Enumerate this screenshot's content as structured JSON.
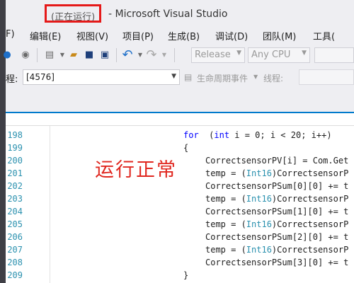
{
  "titlebar": {
    "status": "(正在运行)",
    "app_name": "- Microsoft Visual Studio"
  },
  "menu": {
    "items": [
      "F)",
      "编辑(E)",
      "视图(V)",
      "项目(P)",
      "生成(B)",
      "调试(D)",
      "团队(M)",
      "工具("
    ]
  },
  "toolbar": {
    "configuration": "Release",
    "platform": "Any CPU"
  },
  "debugbar": {
    "process_label": "程:",
    "process_value": "[4576]",
    "lifecycle_label": "生命周期事件",
    "thread_label": "线程:"
  },
  "editor": {
    "line_numbers": [
      "198",
      "199",
      "200",
      "201",
      "202",
      "203",
      "204",
      "205",
      "206",
      "207",
      "208",
      "209"
    ],
    "lines": [
      {
        "indent": "for",
        "parts": [
          [
            "kw",
            "for"
          ],
          [
            "",
            "  ("
          ],
          [
            "kw",
            "int"
          ],
          [
            "",
            " i = 0; i < 20; i++)"
          ]
        ]
      },
      {
        "parts": [
          [
            "",
            "{"
          ]
        ]
      },
      {
        "parts": [
          [
            "",
            "CorrectsensorPV[i] = Com.Get"
          ]
        ]
      },
      {
        "parts": [
          [
            "",
            "temp = ("
          ],
          [
            "ty",
            "Int16"
          ],
          [
            "",
            ")CorrectsensorP"
          ]
        ]
      },
      {
        "parts": [
          [
            "",
            "CorrectsensorPSum[0][0] += t"
          ]
        ]
      },
      {
        "parts": [
          [
            "",
            "temp = ("
          ],
          [
            "ty",
            "Int16"
          ],
          [
            "",
            ")CorrectsensorP"
          ]
        ]
      },
      {
        "parts": [
          [
            "",
            "CorrectsensorPSum[1][0] += t"
          ]
        ]
      },
      {
        "parts": [
          [
            "",
            "temp = ("
          ],
          [
            "ty",
            "Int16"
          ],
          [
            "",
            ")CorrectsensorP"
          ]
        ]
      },
      {
        "parts": [
          [
            "",
            "CorrectsensorPSum[2][0] += t"
          ]
        ]
      },
      {
        "parts": [
          [
            "",
            "temp = ("
          ],
          [
            "ty",
            "Int16"
          ],
          [
            "",
            ")CorrectsensorP"
          ]
        ]
      },
      {
        "parts": [
          [
            "",
            "CorrectsensorPSum[3][0] += t"
          ]
        ]
      },
      {
        "parts": [
          [
            "",
            "}"
          ]
        ]
      }
    ]
  },
  "annotation": {
    "text": "运行正常",
    "color": "#e0271f"
  },
  "colors": {
    "accent": "#007acc",
    "keyword": "#0000ff",
    "type": "#2b91af",
    "highlight_box": "#e51919"
  },
  "icons": [
    "back-icon",
    "forward-icon",
    "new-project-icon",
    "open-file-icon",
    "save-icon",
    "save-all-icon",
    "undo-icon",
    "redo-icon",
    "dropdown-arrow-icon",
    "lifecycle-events-icon"
  ]
}
